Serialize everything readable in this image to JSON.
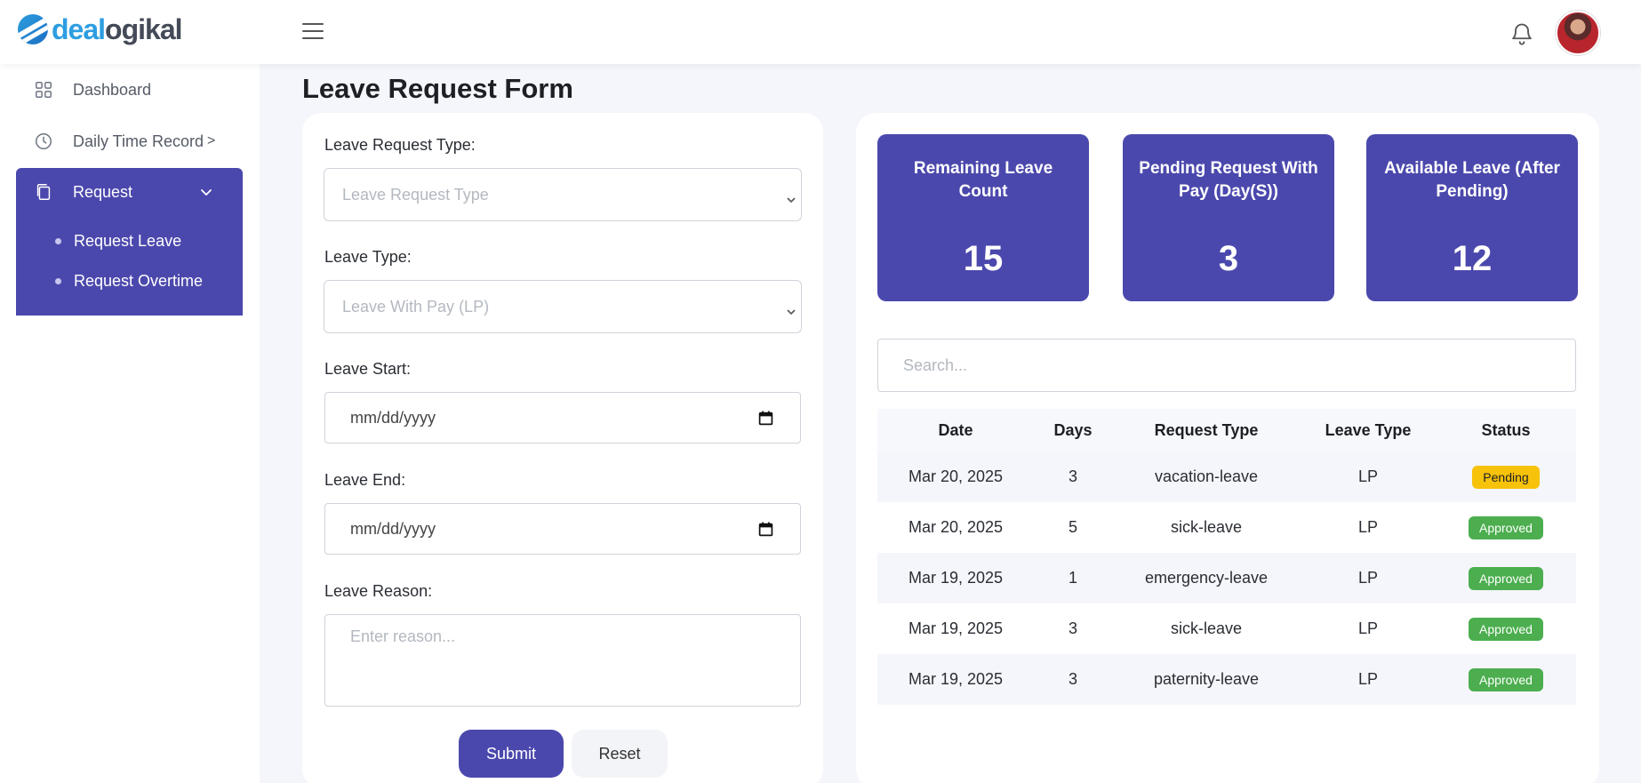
{
  "header": {
    "logo_part1": "deal",
    "logo_part2": "ogikal"
  },
  "sidebar": {
    "items": [
      {
        "label": "Dashboard"
      },
      {
        "label": "Daily Time Record"
      },
      {
        "label": "Request"
      }
    ],
    "dtr_chevron": ">",
    "sub_items": [
      {
        "label": "Request Leave"
      },
      {
        "label": "Request Overtime"
      }
    ]
  },
  "page": {
    "title": "Leave Request Form"
  },
  "form": {
    "leave_request_type_label": "Leave Request Type:",
    "leave_request_type_value": "Leave Request Type",
    "leave_type_label": "Leave Type:",
    "leave_type_value": "Leave With Pay (LP)",
    "leave_start_label": "Leave Start:",
    "leave_start_placeholder": "mm/dd/yyyy",
    "leave_end_label": "Leave End:",
    "leave_end_placeholder": "mm/dd/yyyy",
    "leave_reason_label": "Leave Reason:",
    "leave_reason_placeholder": "Enter reason...",
    "submit_label": "Submit",
    "reset_label": "Reset"
  },
  "stats": [
    {
      "label": "Remaining Leave Count",
      "value": "15"
    },
    {
      "label": "Pending Request With Pay (Day(S))",
      "value": "3"
    },
    {
      "label": "Available Leave (After Pending)",
      "value": "12"
    }
  ],
  "search": {
    "placeholder": "Search..."
  },
  "table": {
    "headers": [
      "Date",
      "Days",
      "Request Type",
      "Leave Type",
      "Status"
    ],
    "rows": [
      {
        "date": "Mar 20, 2025",
        "days": "3",
        "request_type": "vacation-leave",
        "leave_type": "LP",
        "status": "Pending"
      },
      {
        "date": "Mar 20, 2025",
        "days": "5",
        "request_type": "sick-leave",
        "leave_type": "LP",
        "status": "Approved"
      },
      {
        "date": "Mar 19, 2025",
        "days": "1",
        "request_type": "emergency-leave",
        "leave_type": "LP",
        "status": "Approved"
      },
      {
        "date": "Mar 19, 2025",
        "days": "3",
        "request_type": "sick-leave",
        "leave_type": "LP",
        "status": "Approved"
      },
      {
        "date": "Mar 19, 2025",
        "days": "3",
        "request_type": "paternity-leave",
        "leave_type": "LP",
        "status": "Approved"
      }
    ]
  },
  "colors": {
    "accent": "#4b48ad",
    "pending": "#f7c20a",
    "approved": "#4cae4f",
    "logo_blue": "#2d9ee0"
  }
}
